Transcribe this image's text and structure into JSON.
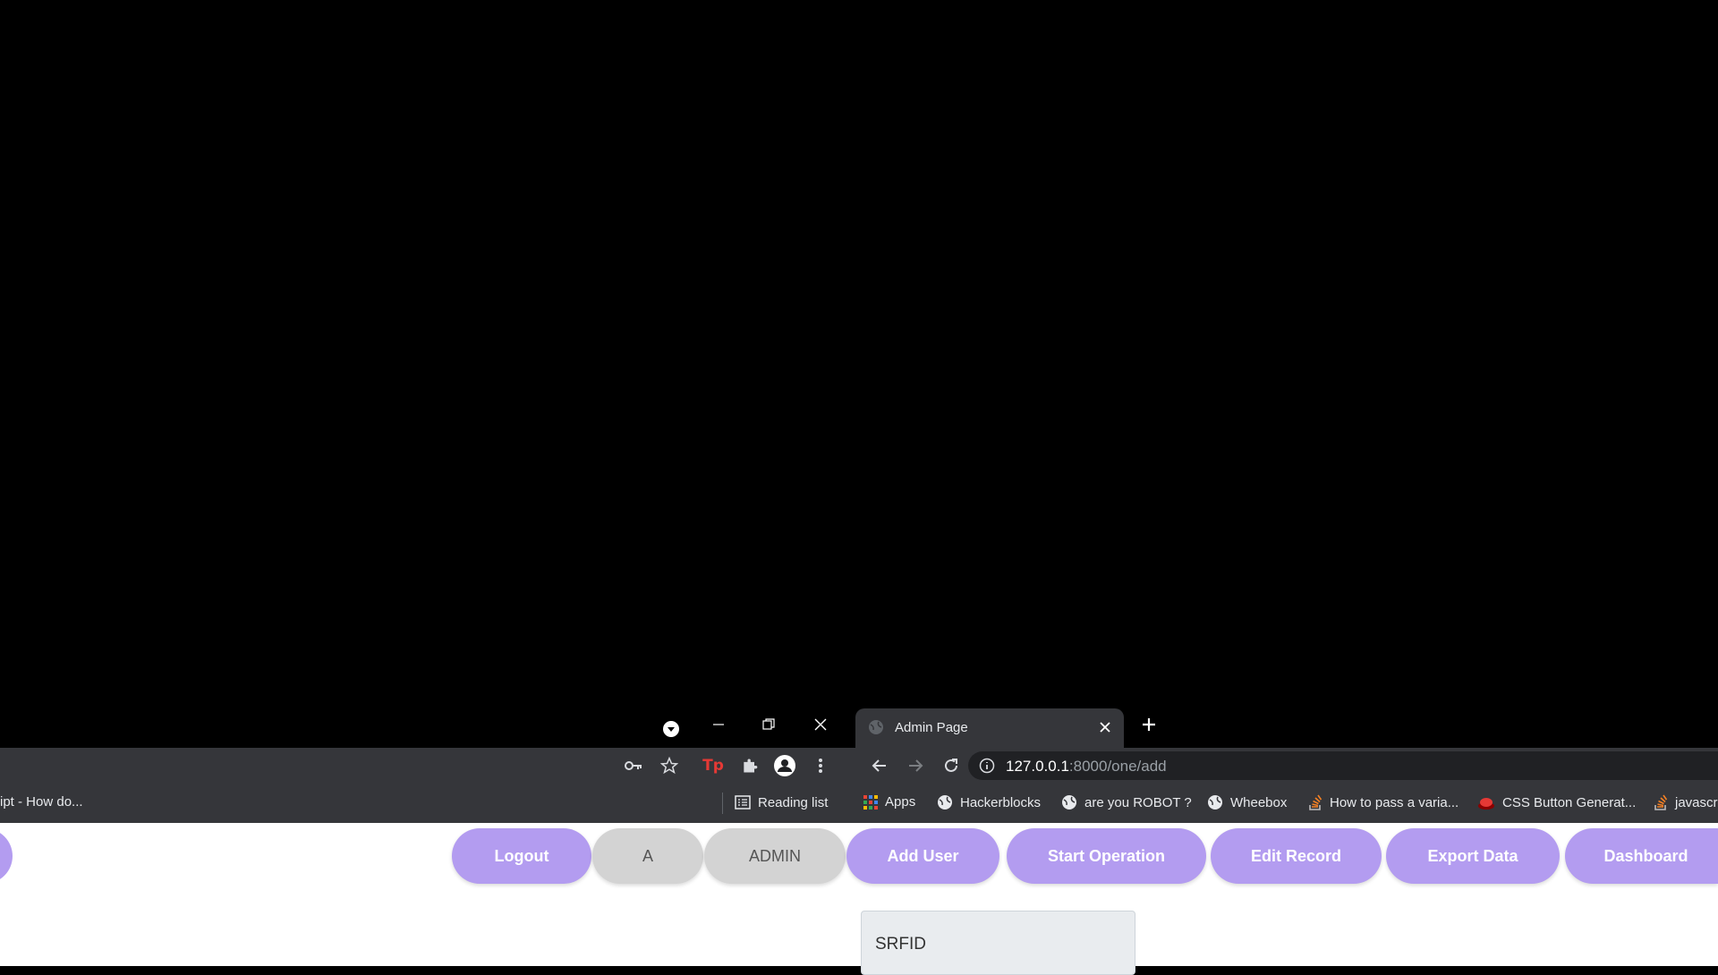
{
  "left_window": {
    "bookmark_text": "ipt - How do...",
    "reading_list_label": "Reading list",
    "controls": [
      "minimize",
      "restore",
      "close"
    ]
  },
  "right_window": {
    "tab_title": "Admin Page",
    "url_host": "127.0.0.1",
    "url_rest": ":8000/one/add",
    "bookmarks": [
      {
        "label": "Apps",
        "icon": "apps-grid-icon"
      },
      {
        "label": "Hackerblocks",
        "icon": "globe-icon"
      },
      {
        "label": "are you ROBOT ?",
        "icon": "globe-icon"
      },
      {
        "label": "Wheebox",
        "icon": "globe-icon"
      },
      {
        "label": "How to pass a varia...",
        "icon": "stackoverflow-icon"
      },
      {
        "label": "CSS Button Generat...",
        "icon": "red-button-icon"
      },
      {
        "label": "javascr",
        "icon": "stackoverflow-icon"
      }
    ]
  },
  "page": {
    "buttons": {
      "logout": "Logout",
      "a": "A",
      "admin": "ADMIN",
      "add_user": "Add User",
      "start_operation": "Start Operation",
      "edit_record": "Edit Record",
      "export_data": "Export Data",
      "dashboard": "Dashboard"
    },
    "srfid_label": "SRFID"
  },
  "colors": {
    "accent": "#b39cf0",
    "grey_button": "#d3d3d3",
    "chrome_toolbar": "#35363a"
  }
}
